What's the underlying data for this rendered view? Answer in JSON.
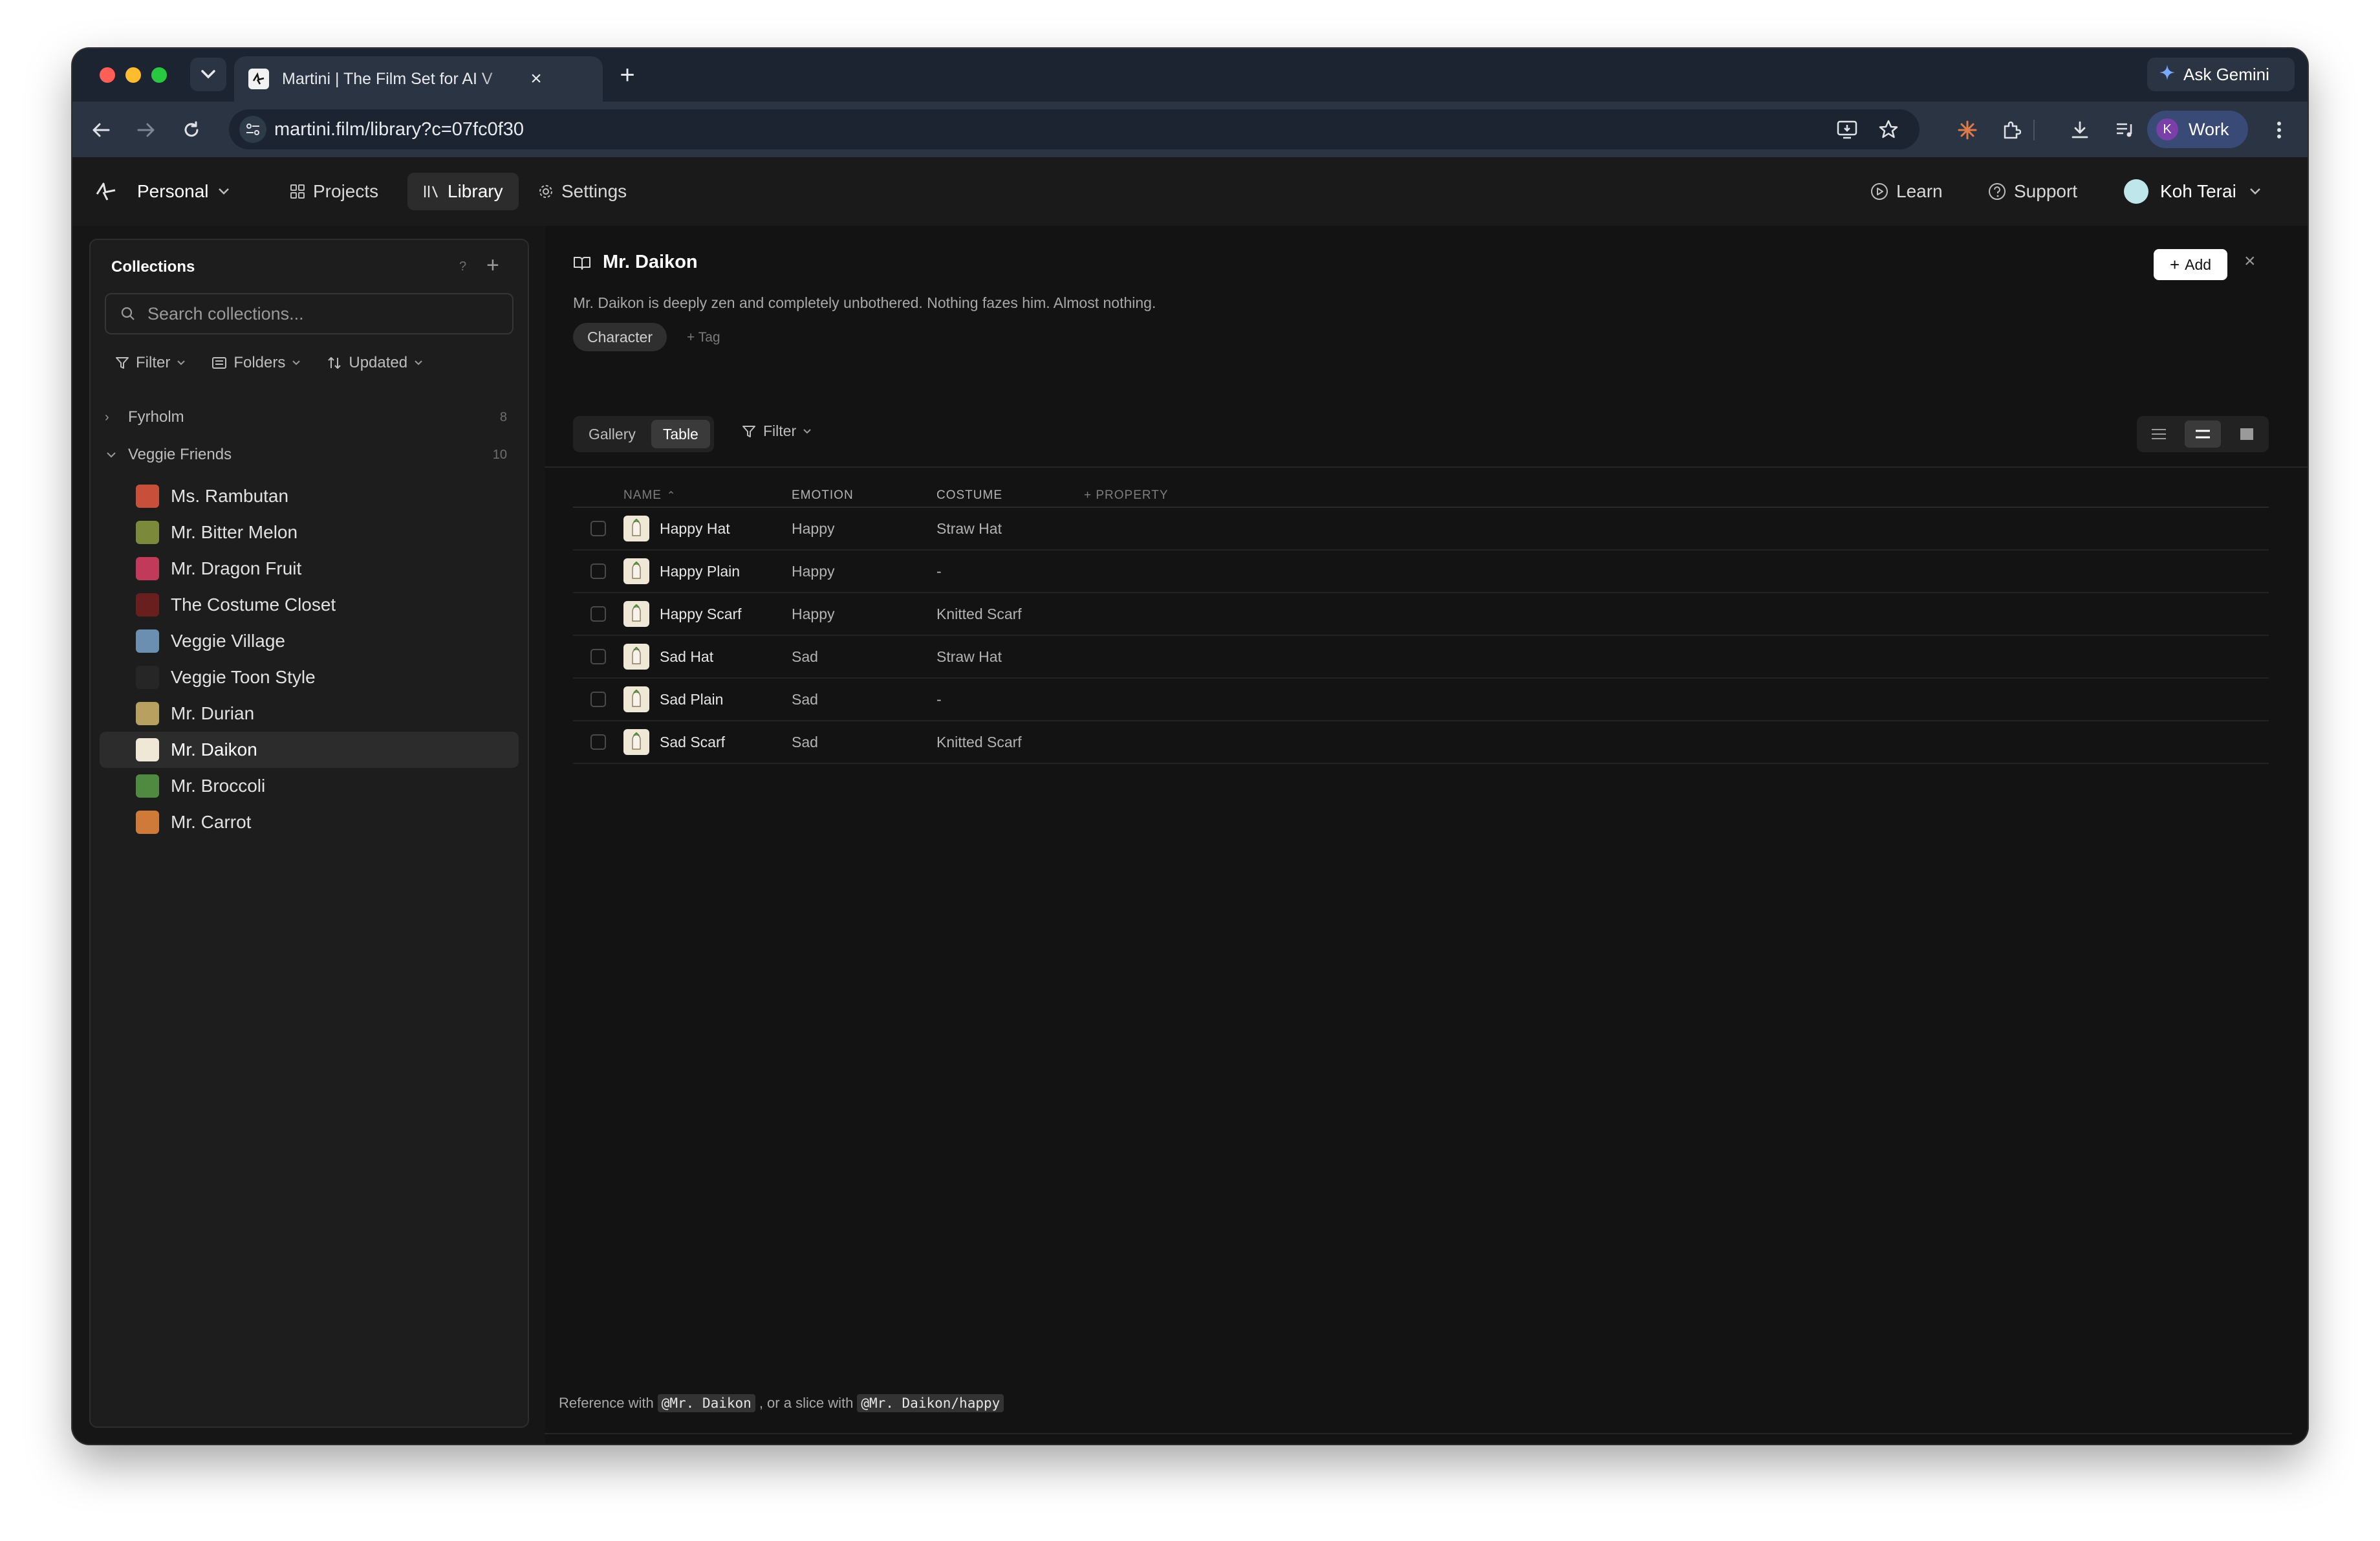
{
  "browser": {
    "tab_title": "Martini | The Film Set for AI V",
    "url": "martini.film/library?c=07fc0f30",
    "ask_gemini": "Ask Gemini",
    "profile_initial": "K",
    "profile_label": "Work"
  },
  "header": {
    "workspace": "Personal",
    "nav": {
      "projects": "Projects",
      "library": "Library",
      "settings": "Settings"
    },
    "learn": "Learn",
    "support": "Support",
    "user_name": "Koh Terai"
  },
  "sidebar": {
    "title": "Collections",
    "help": "?",
    "search_placeholder": "Search collections...",
    "filter_label": "Filter",
    "folders_label": "Folders",
    "sort_label": "Updated",
    "groups": [
      {
        "name": "Fyrholm",
        "count": "8",
        "expanded": false
      },
      {
        "name": "Veggie Friends",
        "count": "10",
        "expanded": true
      }
    ],
    "items": [
      {
        "label": "Ms. Rambutan",
        "thumb_color": "#c8503a"
      },
      {
        "label": "Mr. Bitter Melon",
        "thumb_color": "#7a8a3a"
      },
      {
        "label": "Mr. Dragon Fruit",
        "thumb_color": "#c23a5a"
      },
      {
        "label": "The Costume Closet",
        "thumb_color": "#6a1f1f"
      },
      {
        "label": "Veggie Village",
        "thumb_color": "#6a8fb0"
      },
      {
        "label": "Veggie Toon Style",
        "thumb_color": "#262626"
      },
      {
        "label": "Mr. Durian",
        "thumb_color": "#b8a060"
      },
      {
        "label": "Mr. Daikon",
        "thumb_color": "#efe8d6",
        "active": true
      },
      {
        "label": "Mr. Broccoli",
        "thumb_color": "#4f8a40"
      },
      {
        "label": "Mr. Carrot",
        "thumb_color": "#d07a3a"
      }
    ]
  },
  "main": {
    "title": "Mr. Daikon",
    "add_label": "Add",
    "description": "Mr. Daikon is deeply zen and completely unbothered. Nothing fazes him. Almost nothing.",
    "tag": "Character",
    "add_tag": "+ Tag",
    "view_gallery": "Gallery",
    "view_table": "Table",
    "filter_label": "Filter",
    "columns": {
      "name": "NAME",
      "emotion": "EMOTION",
      "costume": "COSTUME",
      "add_property": "+ PROPERTY"
    },
    "rows": [
      {
        "name": "Happy Hat",
        "emotion": "Happy",
        "costume": "Straw Hat"
      },
      {
        "name": "Happy Plain",
        "emotion": "Happy",
        "costume": "-"
      },
      {
        "name": "Happy Scarf",
        "emotion": "Happy",
        "costume": "Knitted Scarf"
      },
      {
        "name": "Sad Hat",
        "emotion": "Sad",
        "costume": "Straw Hat"
      },
      {
        "name": "Sad Plain",
        "emotion": "Sad",
        "costume": "-"
      },
      {
        "name": "Sad Scarf",
        "emotion": "Sad",
        "costume": "Knitted Scarf"
      }
    ],
    "footer": {
      "prefix": "Reference with",
      "ref": "@Mr. Daikon",
      "middle": ", or a slice with",
      "slice": "@Mr. Daikon/happy"
    }
  },
  "colors": {
    "traffic_red": "#ff5f57",
    "traffic_yellow": "#febc2e",
    "traffic_green": "#28c840",
    "accent_white": "#ffffff"
  },
  "icons": [
    "chevron-down-icon",
    "close-icon",
    "plus-icon",
    "back-arrow-icon",
    "forward-arrow-icon",
    "reload-icon",
    "site-settings-icon",
    "install-icon",
    "star-icon",
    "extension-icon",
    "download-icon",
    "media-icon",
    "menu-dots-icon",
    "logo-icon",
    "grid-icon",
    "library-icon",
    "gear-icon",
    "play-circle-icon",
    "help-circle-icon",
    "search-icon",
    "filter-icon",
    "folder-icon",
    "sort-icon",
    "book-icon",
    "list-icon",
    "rows-icon",
    "block-icon"
  ]
}
